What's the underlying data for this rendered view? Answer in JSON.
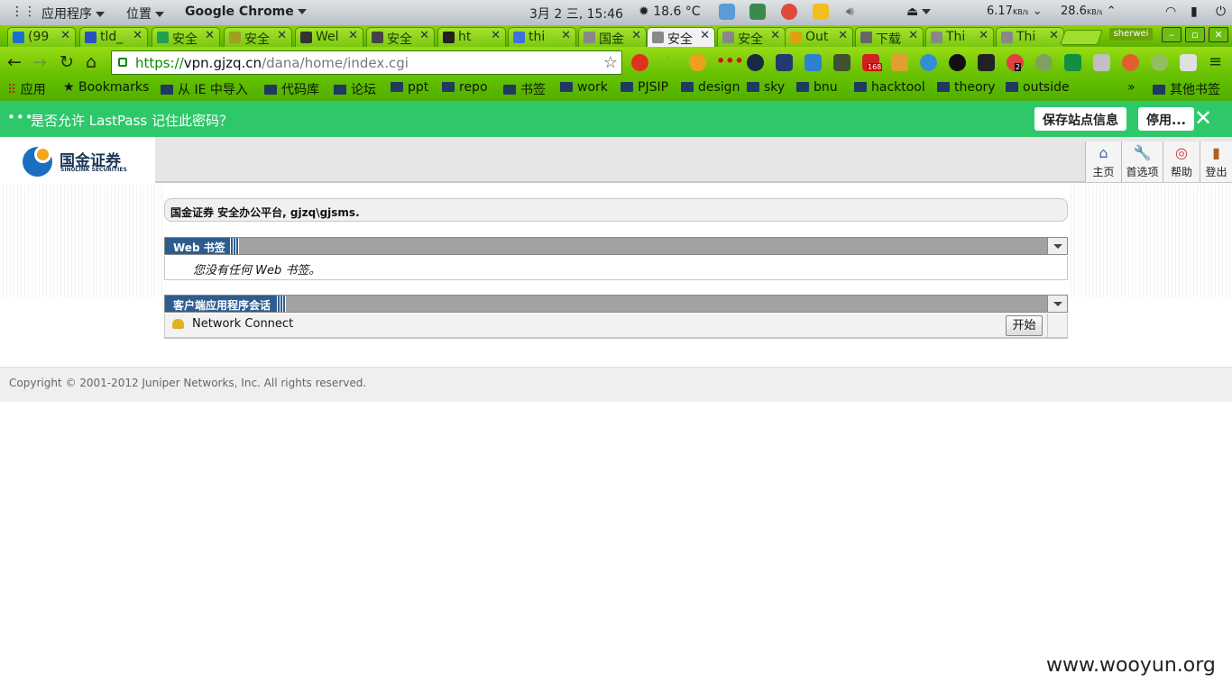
{
  "system_bar": {
    "apps": "应用程序",
    "places": "位置",
    "app_name": "Google Chrome",
    "clock": "3月 2 三, 15:46",
    "weather": "18.6 °C",
    "net_down": "6.17",
    "net_down_unit": "KB/s",
    "net_up": "28.6",
    "net_up_unit": "KB/s"
  },
  "tabs": [
    {
      "label": "(99"
    },
    {
      "label": "tld_"
    },
    {
      "label": "安全"
    },
    {
      "label": "安全"
    },
    {
      "label": "Wel"
    },
    {
      "label": "安全"
    },
    {
      "label": "ht"
    },
    {
      "label": "thi"
    },
    {
      "label": "国金"
    },
    {
      "label": "安全",
      "active": true
    },
    {
      "label": "安全"
    },
    {
      "label": "Out"
    },
    {
      "label": "下载"
    },
    {
      "label": "Thi"
    },
    {
      "label": "Thi"
    }
  ],
  "window": {
    "user": "sherwei"
  },
  "address_bar": {
    "scheme": "https://",
    "host": "vpn.gjzq.cn",
    "path": "/dana/home/index.cgi"
  },
  "extensions": {
    "badge_mail": "168",
    "badge_count": "2"
  },
  "bookmarks": [
    {
      "label": "应用",
      "kind": "apps"
    },
    {
      "label": "Bookmarks",
      "kind": "star"
    },
    {
      "label": "从 IE 中导入",
      "kind": "folder"
    },
    {
      "label": "代码库",
      "kind": "folder"
    },
    {
      "label": "论坛",
      "kind": "folder"
    },
    {
      "label": "ppt",
      "kind": "folder"
    },
    {
      "label": "repo",
      "kind": "folder"
    },
    {
      "label": "书签",
      "kind": "folder"
    },
    {
      "label": "work",
      "kind": "folder"
    },
    {
      "label": "PJSIP",
      "kind": "folder"
    },
    {
      "label": "design",
      "kind": "folder"
    },
    {
      "label": "sky",
      "kind": "folder"
    },
    {
      "label": "bnu",
      "kind": "folder"
    },
    {
      "label": "hacktool",
      "kind": "folder"
    },
    {
      "label": "theory",
      "kind": "folder"
    },
    {
      "label": "outside",
      "kind": "folder"
    }
  ],
  "bookmarks_more": "»",
  "other_bookmarks": "其他书签",
  "lastpass": {
    "message": "是否允许 LastPass 记住此密码？",
    "save_site": "保存站点信息",
    "disable": "停用...",
    "close": "✕"
  },
  "site": {
    "logo_cn": "国金证券",
    "logo_en": "SINOLINK SECURITIES",
    "nav": [
      {
        "label": "主页",
        "icon": "home-icon",
        "glyph": "⌂"
      },
      {
        "label": "首选项",
        "icon": "wrench-icon",
        "glyph": "🔧"
      },
      {
        "label": "帮助",
        "icon": "lifebuoy-icon",
        "glyph": "◎"
      },
      {
        "label": "登出",
        "icon": "door-icon",
        "glyph": "▮"
      }
    ],
    "welcome": "国金证券 安全办公平台, gjzq\\gjsms.",
    "web_bookmarks": {
      "title": "Web 书签",
      "empty": "您没有任何 Web 书签。"
    },
    "client_apps": {
      "title": "客户端应用程序会话",
      "item_name": "Network Connect",
      "start": "开始"
    },
    "footer": "Copyright © 2001-2012 Juniper Networks, Inc. All rights reserved."
  },
  "watermark": "www.wooyun.org",
  "colors": {
    "chrome_theme": "#62bd00",
    "lastpass": "#2ec86b",
    "juniper_blue": "#2e5c8e"
  }
}
